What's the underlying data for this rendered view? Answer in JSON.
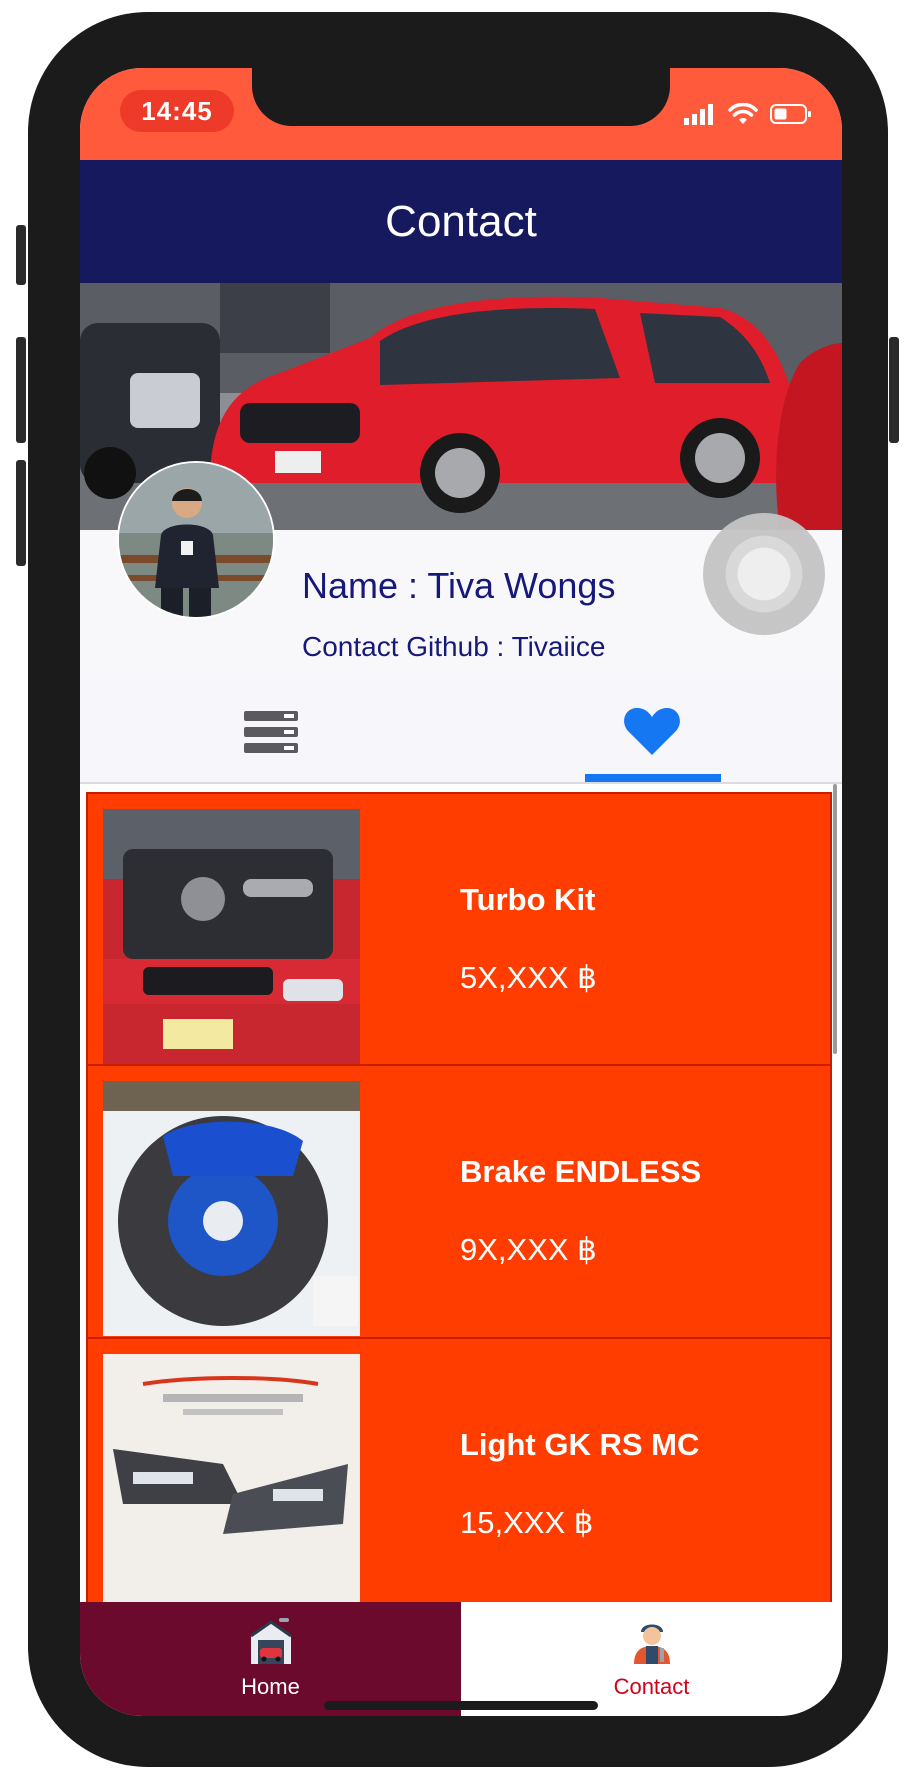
{
  "status_bar": {
    "time": "14:45"
  },
  "app_bar": {
    "title": "Contact"
  },
  "profile": {
    "name": "Name : Tiva Wongs",
    "github": "Contact Github : Tivaiice"
  },
  "tabs": [
    {
      "icon": "list-icon",
      "selected": false
    },
    {
      "icon": "heart-icon",
      "selected": true
    }
  ],
  "items": [
    {
      "title": "Turbo Kit",
      "price": "5X,XXX ฿",
      "image": "engine-bay-photo"
    },
    {
      "title": "Brake ENDLESS",
      "price": "9X,XXX ฿",
      "image": "brake-caliper-photo"
    },
    {
      "title": "Light GK RS MC",
      "price": "15,XXX ฿",
      "image": "headlight-photo"
    }
  ],
  "bottom_nav": {
    "home_label": "Home",
    "contact_label": "Contact",
    "selected": "Contact"
  },
  "colors": {
    "status_bar": "#ff5a3c",
    "app_bar": "#17195e",
    "card": "#ff3d00",
    "tab_indicator": "#1677f2",
    "nav_home": "#6c0a2e",
    "nav_contact_label": "#d0021b"
  }
}
